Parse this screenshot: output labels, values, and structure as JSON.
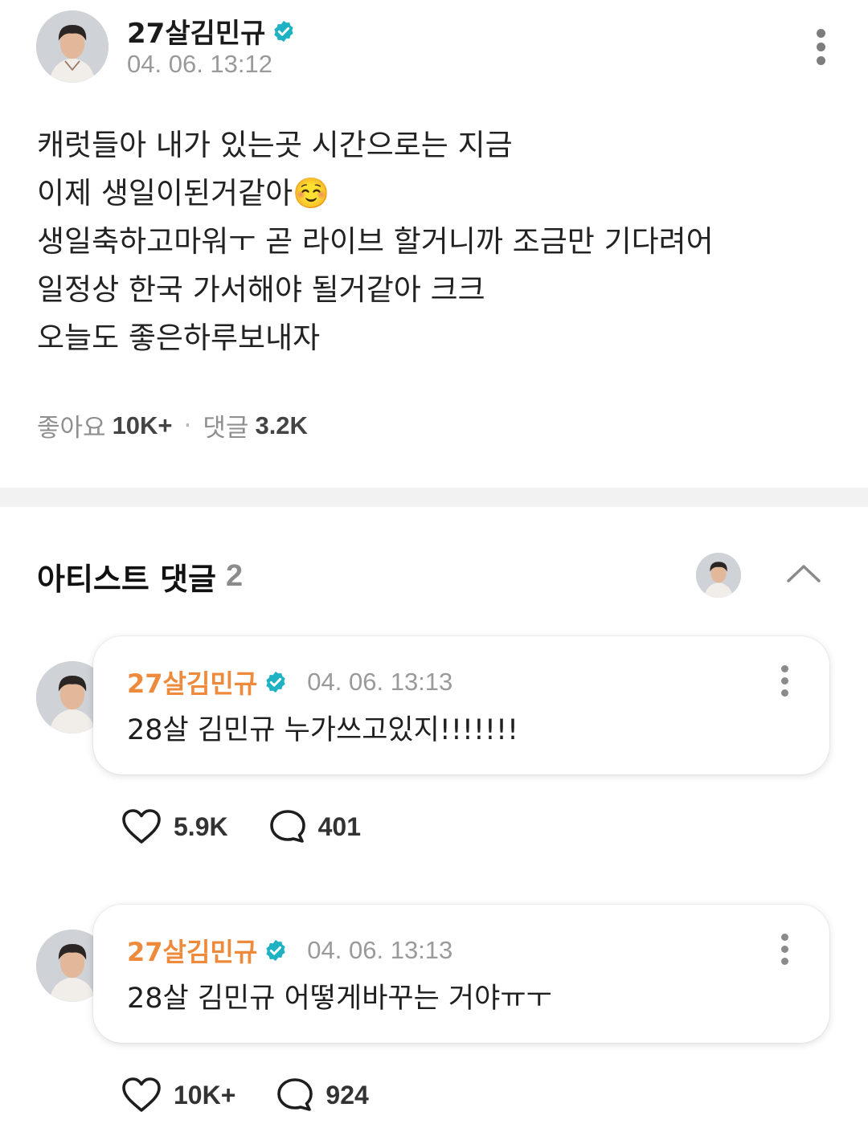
{
  "post": {
    "author": "27살김민규",
    "date": "04. 06. 13:12",
    "body_lines": [
      "캐럿들아 내가 있는곳 시간으로는 지금",
      "이제 생일이된거같아☺️",
      "생일축하고마워ㅜ 곧 라이브 할거니까 조금만 기다려어",
      "일정상 한국 가서해야 될거같아 크크",
      "오늘도 좋은하루보내자"
    ],
    "likes_label": "좋아요",
    "likes_count": "10K+",
    "separator": "·",
    "comments_label": "댓글",
    "comments_count": "3.2K"
  },
  "artist_comments": {
    "title": "아티스트 댓글",
    "count": "2",
    "items": [
      {
        "author": "27살김민규",
        "date": "04. 06. 13:13",
        "text": "28살 김민규 누가쓰고있지!!!!!!!",
        "likes": "5.9K",
        "replies": "401"
      },
      {
        "author": "27살김민규",
        "date": "04. 06. 13:13",
        "text": "28살 김민규 어떻게바꾸는 거야ㅠㅜ",
        "likes": "10K+",
        "replies": "924"
      }
    ]
  },
  "colors": {
    "accent_orange": "#ee8a3b",
    "verified_teal": "#1fb2c3",
    "muted_text": "#9a9a9a"
  },
  "icons": [
    "verified-badge-icon",
    "more-vertical-icon",
    "chevron-up-icon",
    "heart-icon",
    "comment-bubble-icon"
  ]
}
